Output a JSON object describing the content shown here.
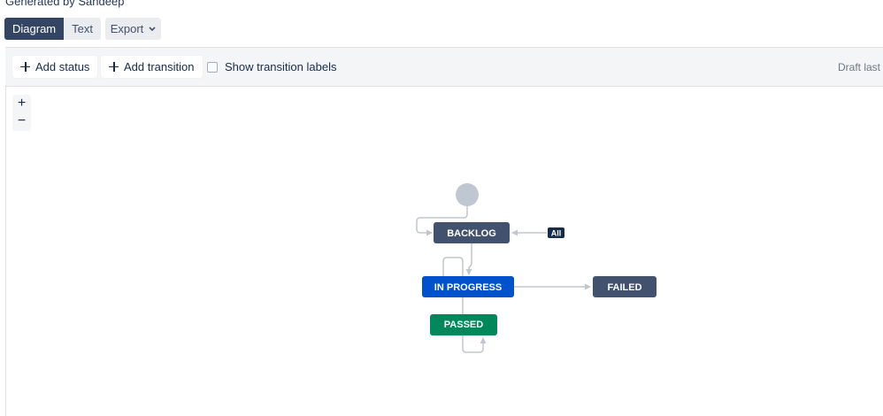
{
  "header": {
    "subtitle": "Generated by Sandeep",
    "view_tabs": [
      "Diagram",
      "Text"
    ],
    "export_label": "Export"
  },
  "toolbar": {
    "add_status_label": "Add status",
    "add_transition_label": "Add transition",
    "show_labels_label": "Show transition labels",
    "show_labels_checked": false,
    "draft_text": "Draft last s"
  },
  "zoom": {
    "in_label": "+",
    "out_label": "−"
  },
  "workflow": {
    "statuses": [
      {
        "name": "BACKLOG",
        "color": "#42526e"
      },
      {
        "name": "IN PROGRESS",
        "color": "#0052cc"
      },
      {
        "name": "FAILED",
        "color": "#42526e"
      },
      {
        "name": "PASSED",
        "color": "#00875a"
      }
    ],
    "all_badge": "All"
  },
  "colors": {
    "toolbar_bg": "#f4f5f7",
    "active_tab": "#344563",
    "connector": "#c1c7d0",
    "start_node": "#c1c7d0"
  }
}
